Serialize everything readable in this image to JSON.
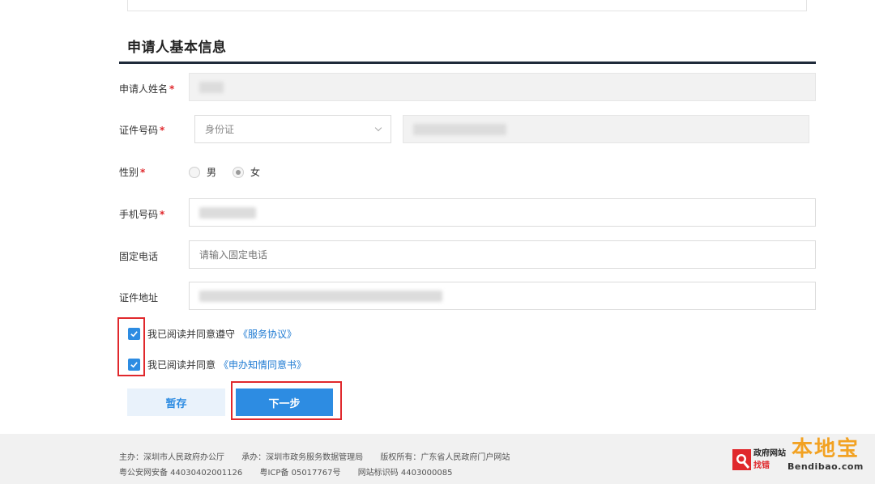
{
  "section": {
    "title": "申请人基本信息"
  },
  "form": {
    "name": {
      "label": "申请人姓名",
      "required": "*"
    },
    "id_number": {
      "label": "证件号码",
      "required": "*",
      "type_value": "身份证"
    },
    "gender": {
      "label": "性别",
      "required": "*",
      "options": [
        "男",
        "女"
      ],
      "selected": "女"
    },
    "mobile": {
      "label": "手机号码",
      "required": "*"
    },
    "landline": {
      "label": "固定电话",
      "placeholder": "请输入固定电话"
    },
    "address": {
      "label": "证件地址"
    }
  },
  "agreements": [
    {
      "text": "我已阅读并同意遵守",
      "link": "《服务协议》",
      "checked": true
    },
    {
      "text": "我已阅读并同意",
      "link": "《申办知情同意书》",
      "checked": true
    }
  ],
  "buttons": {
    "save": "暂存",
    "next": "下一步"
  },
  "footer": {
    "sponsor": "主办：深圳市人民政府办公厅",
    "operator": "承办：深圳市政务服务数据管理局",
    "copyright": "版权所有：广东省人民政府门户网站",
    "police": "粤公安网安备 44030402001126",
    "icp": "粤ICP备 05017767号",
    "site_id": "网站标识码 4403000085"
  },
  "gov_logo": {
    "line1": "政府网站",
    "line2": "找错"
  },
  "watermark": {
    "cn": "本地宝",
    "en": "Bendibao.com"
  },
  "colors": {
    "accent": "#2d8ce2",
    "required": "#e0282c",
    "highlight": "#e0282c"
  }
}
